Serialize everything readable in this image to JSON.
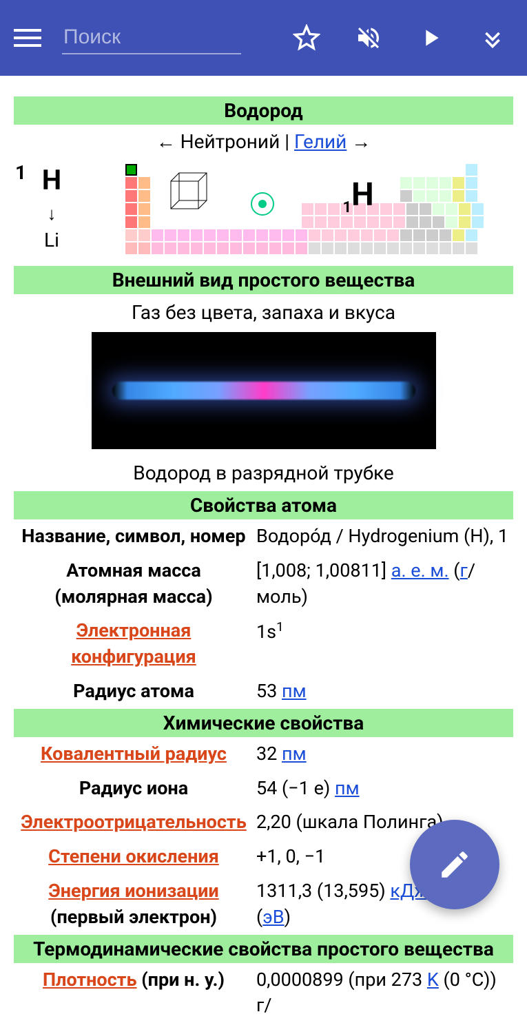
{
  "search": {
    "placeholder": "Поиск"
  },
  "element": {
    "title": "Водород",
    "nav_prev": "Нейтроний",
    "nav_next": "Гелий",
    "atomic_number": "1",
    "symbol": "H",
    "arrow_down": "↓",
    "below_symbol": "Li",
    "big_symbol_sub": "1",
    "big_symbol": "H"
  },
  "sections": {
    "appearance": "Внешний вид простого вещества",
    "atom_props": "Свойства атома",
    "chem_props": "Химические свойства",
    "thermo_props": "Термодинамические свойства простого вещества"
  },
  "appearance": {
    "description": "Газ без цвета, запаха и вкуса",
    "caption": "Водород в разрядной трубке"
  },
  "atom": {
    "name_label": "Название, символ, номер",
    "name_value": "Водоро́д / Hydrogenium (H), 1",
    "mass_label_1": "Атомная масса",
    "mass_label_2": "(молярная масса)",
    "mass_value_prefix": "[1,008; 1,00811] ",
    "mass_unit_1": "а. е. м.",
    "mass_unit_2": "г",
    "mass_value_suffix": "/моль)",
    "econf_label_1": "Электронная",
    "econf_label_2": "конфигурация",
    "econf_value": "1s",
    "econf_sup": "1",
    "radius_label": "Радиус атома",
    "radius_value": "53 ",
    "radius_unit": "пм"
  },
  "chem": {
    "cov_radius_label": "Ковалентный радиус",
    "cov_radius_value": "32 ",
    "cov_radius_unit": "пм",
    "ion_radius_label": "Радиус иона",
    "ion_radius_value": "54 (−1 e) ",
    "ion_radius_unit": "пм",
    "eneg_label": "Электроотрицательность",
    "eneg_value": "2,20 (шкала Полинга)",
    "oxid_label": "Степени окисления",
    "oxid_value": "+1, 0, −1",
    "ioniz_label_1": "Энергия ионизации",
    "ioniz_label_2": "(первый электрон)",
    "ioniz_value_prefix": " 1311,3 (13,595) ",
    "ioniz_unit_1": "кДж",
    "ioniz_value_mid": "/моль (",
    "ioniz_unit_2": "эВ",
    "ioniz_value_suffix": ")"
  },
  "thermo": {
    "density_label": "Плотность",
    "density_label_suffix": " (при н. у.)",
    "density_value_prefix": "0,0000899 (при 273 ",
    "density_unit_k": "K",
    "density_value_suffix": " (0 °C)) г/"
  }
}
